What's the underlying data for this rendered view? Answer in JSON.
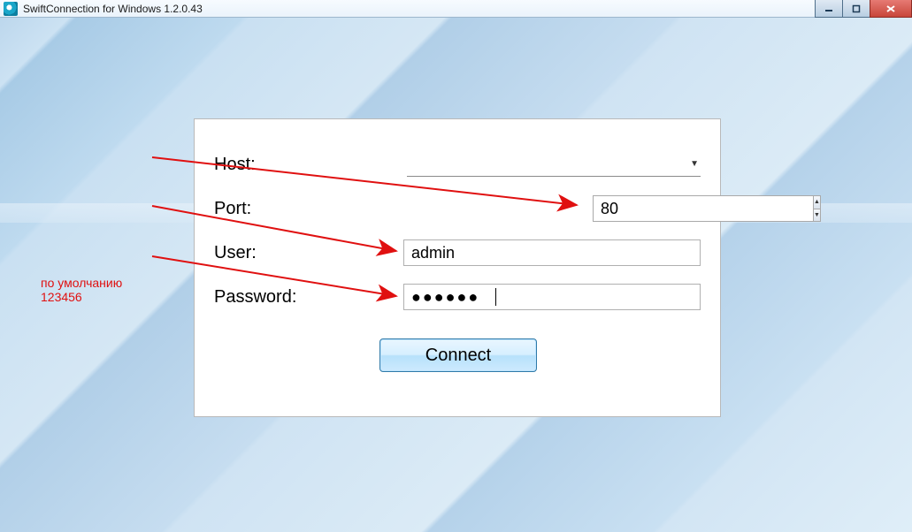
{
  "titlebar": {
    "title": "SwiftConnection for Windows 1.2.0.43"
  },
  "form": {
    "host_label": "Host:",
    "host_value": "",
    "port_label": "Port:",
    "port_value": "80",
    "user_label": "User:",
    "user_value": "admin",
    "password_label": "Password:",
    "password_masked": "●●●●●●",
    "connect_label": "Connect"
  },
  "annotation": {
    "line1": "по умолчанию",
    "line2": "123456"
  }
}
